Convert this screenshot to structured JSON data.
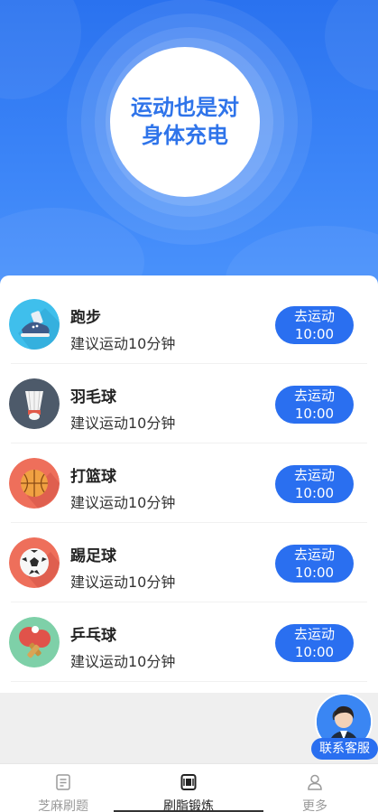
{
  "hero": {
    "slogan": "运动也是对身体充电"
  },
  "activities": [
    {
      "title": "跑步",
      "subtitle": "建议运动10分钟",
      "button_label": "去运动",
      "button_time": "10:00",
      "icon": "running-shoe-icon",
      "color": "#3fbfec"
    },
    {
      "title": "羽毛球",
      "subtitle": "建议运动10分钟",
      "button_label": "去运动",
      "button_time": "10:00",
      "icon": "badminton-icon",
      "color": "#4d5a6a"
    },
    {
      "title": "打篮球",
      "subtitle": "建议运动10分钟",
      "button_label": "去运动",
      "button_time": "10:00",
      "icon": "basketball-icon",
      "color": "#ee6f5b"
    },
    {
      "title": "踢足球",
      "subtitle": "建议运动10分钟",
      "button_label": "去运动",
      "button_time": "10:00",
      "icon": "soccer-ball-icon",
      "color": "#ee6f5b"
    },
    {
      "title": "乒乓球",
      "subtitle": "建议运动10分钟",
      "button_label": "去运动",
      "button_time": "10:00",
      "icon": "ping-pong-icon",
      "color": "#7ed0a8"
    }
  ],
  "customer_service": {
    "label": "联系客服"
  },
  "tabbar": {
    "tabs": [
      {
        "label": "芝麻刷题",
        "icon": "document-icon",
        "active": false
      },
      {
        "label": "刷脂锻炼",
        "icon": "workout-icon",
        "active": true
      },
      {
        "label": "更多",
        "icon": "user-icon",
        "active": false
      }
    ]
  },
  "colors": {
    "primary": "#2a6ff0",
    "hero_top": "#2a72ef",
    "hero_bottom": "#4a92fb"
  }
}
